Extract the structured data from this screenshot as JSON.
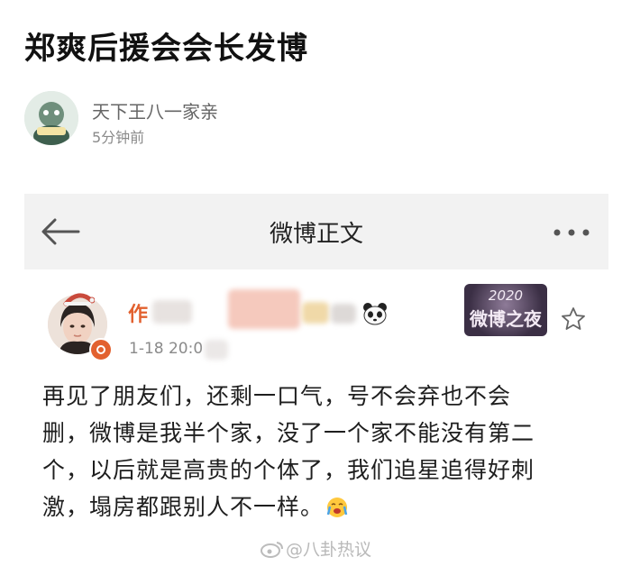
{
  "post": {
    "title": "郑爽后援会会长发博",
    "author": "天下王八一家亲",
    "time": "5分钟前"
  },
  "screenshot": {
    "header_title": "微博正文",
    "user_name_visible": "作",
    "post_time": "1-18 20:0",
    "event_badge": {
      "year": "2020",
      "name": "微博之夜"
    },
    "body_lines": [
      "再见了朋友们，还剩一口气，号不会弃也不会",
      "删，微博是我半个家，没了一个家不能没有第二",
      "个，以后就是高贵的个体了，我们追星追得好刺",
      "激，塌房都跟别人不一样。"
    ],
    "watermark": "@八卦热议"
  },
  "colors": {
    "accent": "#e2612f",
    "header_bg": "#f2f2f2"
  },
  "icons": [
    "back-arrow-icon",
    "more-dots-icon",
    "panda-icon",
    "star-icon",
    "crying-emoji-icon",
    "weibo-logo-icon"
  ]
}
